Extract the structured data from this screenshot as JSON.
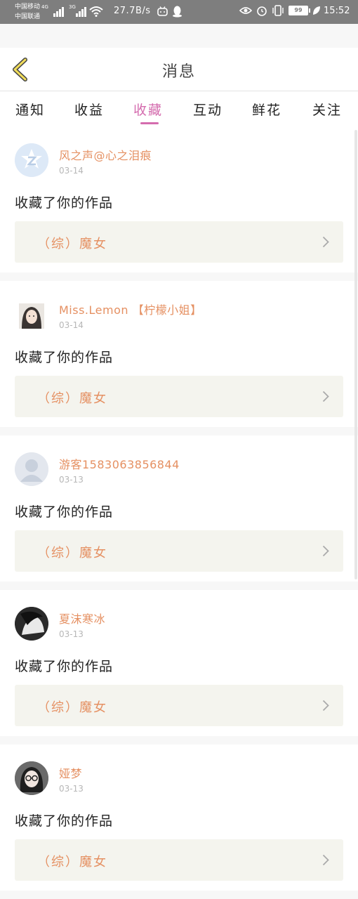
{
  "status_bar": {
    "carrier1": "中国移动",
    "carrier1_net": "4G",
    "carrier2": "中国联通",
    "carrier2_net": "3G",
    "speed": "27.7B/s",
    "battery": "99",
    "time": "15:52"
  },
  "header": {
    "title": "消息"
  },
  "tabs": [
    {
      "label": "通知",
      "active": false
    },
    {
      "label": "收益",
      "active": false
    },
    {
      "label": "收藏",
      "active": true
    },
    {
      "label": "互动",
      "active": false
    },
    {
      "label": "鲜花",
      "active": false
    },
    {
      "label": "关注",
      "active": false
    }
  ],
  "messages": [
    {
      "user": "风之声@心之泪痕",
      "date": "03-14",
      "action": "收藏了你的作品",
      "work": "（综）魔女",
      "avatar": "zhihu-style-z"
    },
    {
      "user": "Miss.Lemon 【柠檬小姐】",
      "date": "03-14",
      "action": "收藏了你的作品",
      "work": "（综）魔女",
      "avatar": "girl-photo"
    },
    {
      "user": "游客1583063856844",
      "date": "03-13",
      "action": "收藏了你的作品",
      "work": "（综）魔女",
      "avatar": "default-person"
    },
    {
      "user": "夏沫寒冰",
      "date": "03-13",
      "action": "收藏了你的作品",
      "work": "（综）魔女",
      "avatar": "dark-photo"
    },
    {
      "user": "娅梦",
      "date": "03-13",
      "action": "收藏了你的作品",
      "work": "（综）魔女",
      "avatar": "glasses-photo"
    }
  ],
  "colors": {
    "accent": "#d46cae",
    "username": "#e59062",
    "card_bg": "#f4f4ee"
  }
}
